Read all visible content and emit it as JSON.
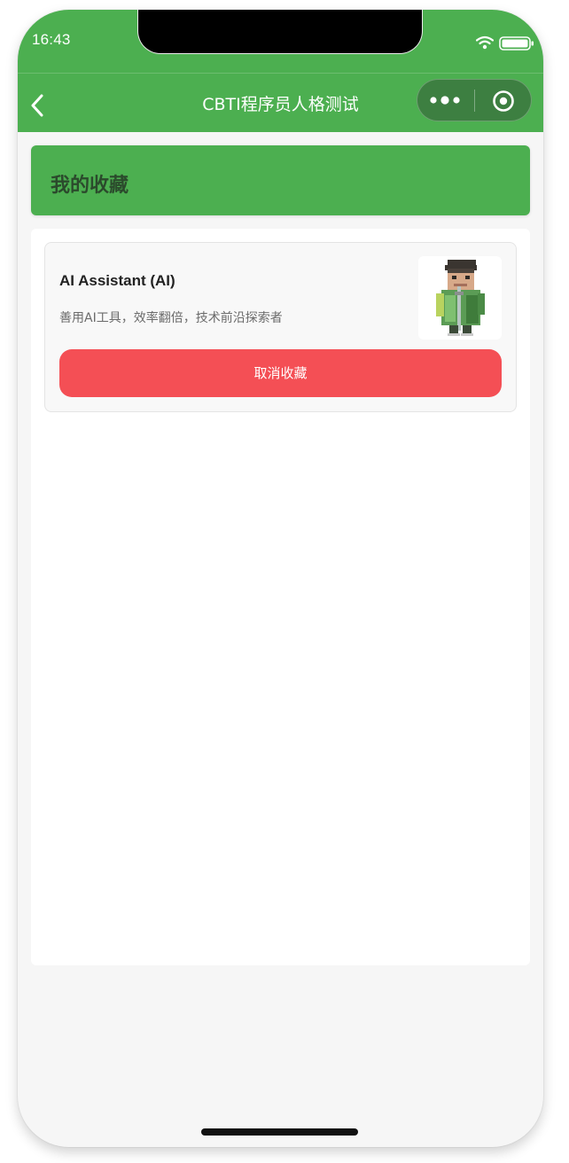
{
  "status_bar": {
    "time": "16:43"
  },
  "nav": {
    "title": "CBTI程序员人格测试",
    "back_icon": "chevron-left-icon",
    "more_icon": "more-dots-icon",
    "close_icon": "target-close-icon"
  },
  "page": {
    "title": "我的收藏"
  },
  "favorites": [
    {
      "name": "AI Assistant (AI)",
      "description": "善用AI工具，效率翻倍，技术前沿探索者",
      "avatar_icon": "pixel-warrior-avatar",
      "unfavorite_label": "取消收藏"
    }
  ],
  "colors": {
    "primary": "#4caf50",
    "danger": "#f44f55",
    "page_bg": "#f6f6f6"
  }
}
